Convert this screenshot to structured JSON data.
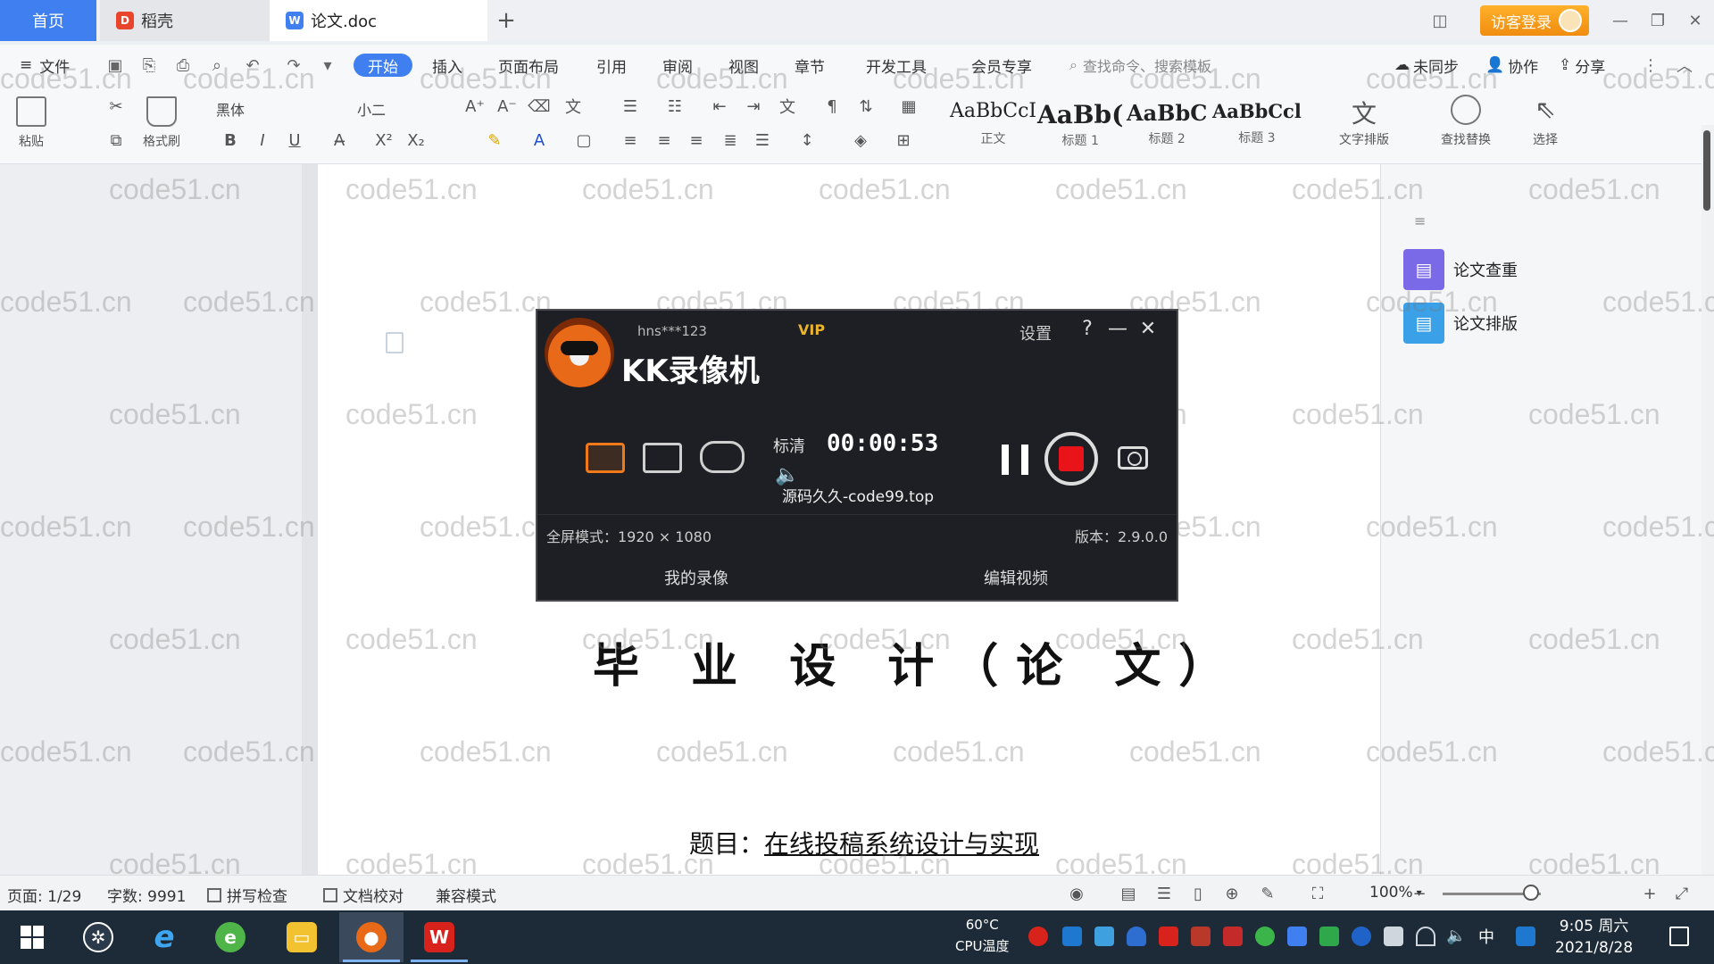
{
  "tabs": [
    {
      "label": "首页"
    },
    {
      "label": "稻壳"
    },
    {
      "label": "论文.doc"
    }
  ],
  "titlebar": {
    "guest_login": "访客登录"
  },
  "menu": {
    "file": "文件",
    "items": [
      "开始",
      "插入",
      "页面布局",
      "引用",
      "审阅",
      "视图",
      "章节",
      "开发工具",
      "会员专享"
    ],
    "search_cmd": "查找命令、搜索模板",
    "sync": "未同步",
    "collab": "协作",
    "share": "分享"
  },
  "ribbon": {
    "paste": "粘贴",
    "format_painter": "格式刷",
    "font_name": "黑体",
    "font_size": "小二",
    "styles": [
      {
        "sample": "AaBbCcI",
        "name": "正文"
      },
      {
        "sample": "AaBb(",
        "name": "标题 1"
      },
      {
        "sample": "AaBbC",
        "name": "标题 2"
      },
      {
        "sample": "AaBbCcl",
        "name": "标题 3"
      }
    ],
    "text_tools": "文字排版",
    "find_replace": "查找替换",
    "select": "选择"
  },
  "side_panel": {
    "check": "论文查重",
    "layout": "论文排版"
  },
  "document": {
    "title": "毕 业 设 计（论 文）",
    "topic_label": "题目：",
    "topic_value": "在线投稿系统设计与实现"
  },
  "recorder": {
    "app_name": "KK录像机",
    "user": "hns***123",
    "vip": "VIP",
    "settings": "设置",
    "quality": "标清",
    "timer": "00:00:53",
    "source_text": "源码久久-code99.top",
    "fullscreen_mode": "全屏模式：1920 × 1080",
    "version": "版本：2.9.0.0",
    "my_recordings": "我的录像",
    "edit_video": "编辑视频"
  },
  "statusbar": {
    "page": "页面: 1/29",
    "words": "字数: 9991",
    "spell_check": "拼写检查",
    "doc_proof": "文档校对",
    "compat_mode": "兼容模式",
    "zoom": "100%"
  },
  "taskbar": {
    "cpu_temp": "60°C",
    "cpu_label": "CPU温度",
    "ime": "中",
    "time": "9:05 周六",
    "date": "2021/8/28"
  },
  "watermark": "code51.cn",
  "colors": {
    "accent": "#3f7ff0",
    "record_stop": "#e8141a",
    "guest_btn": "#f5a020",
    "taskbar": "#1d2a38"
  }
}
